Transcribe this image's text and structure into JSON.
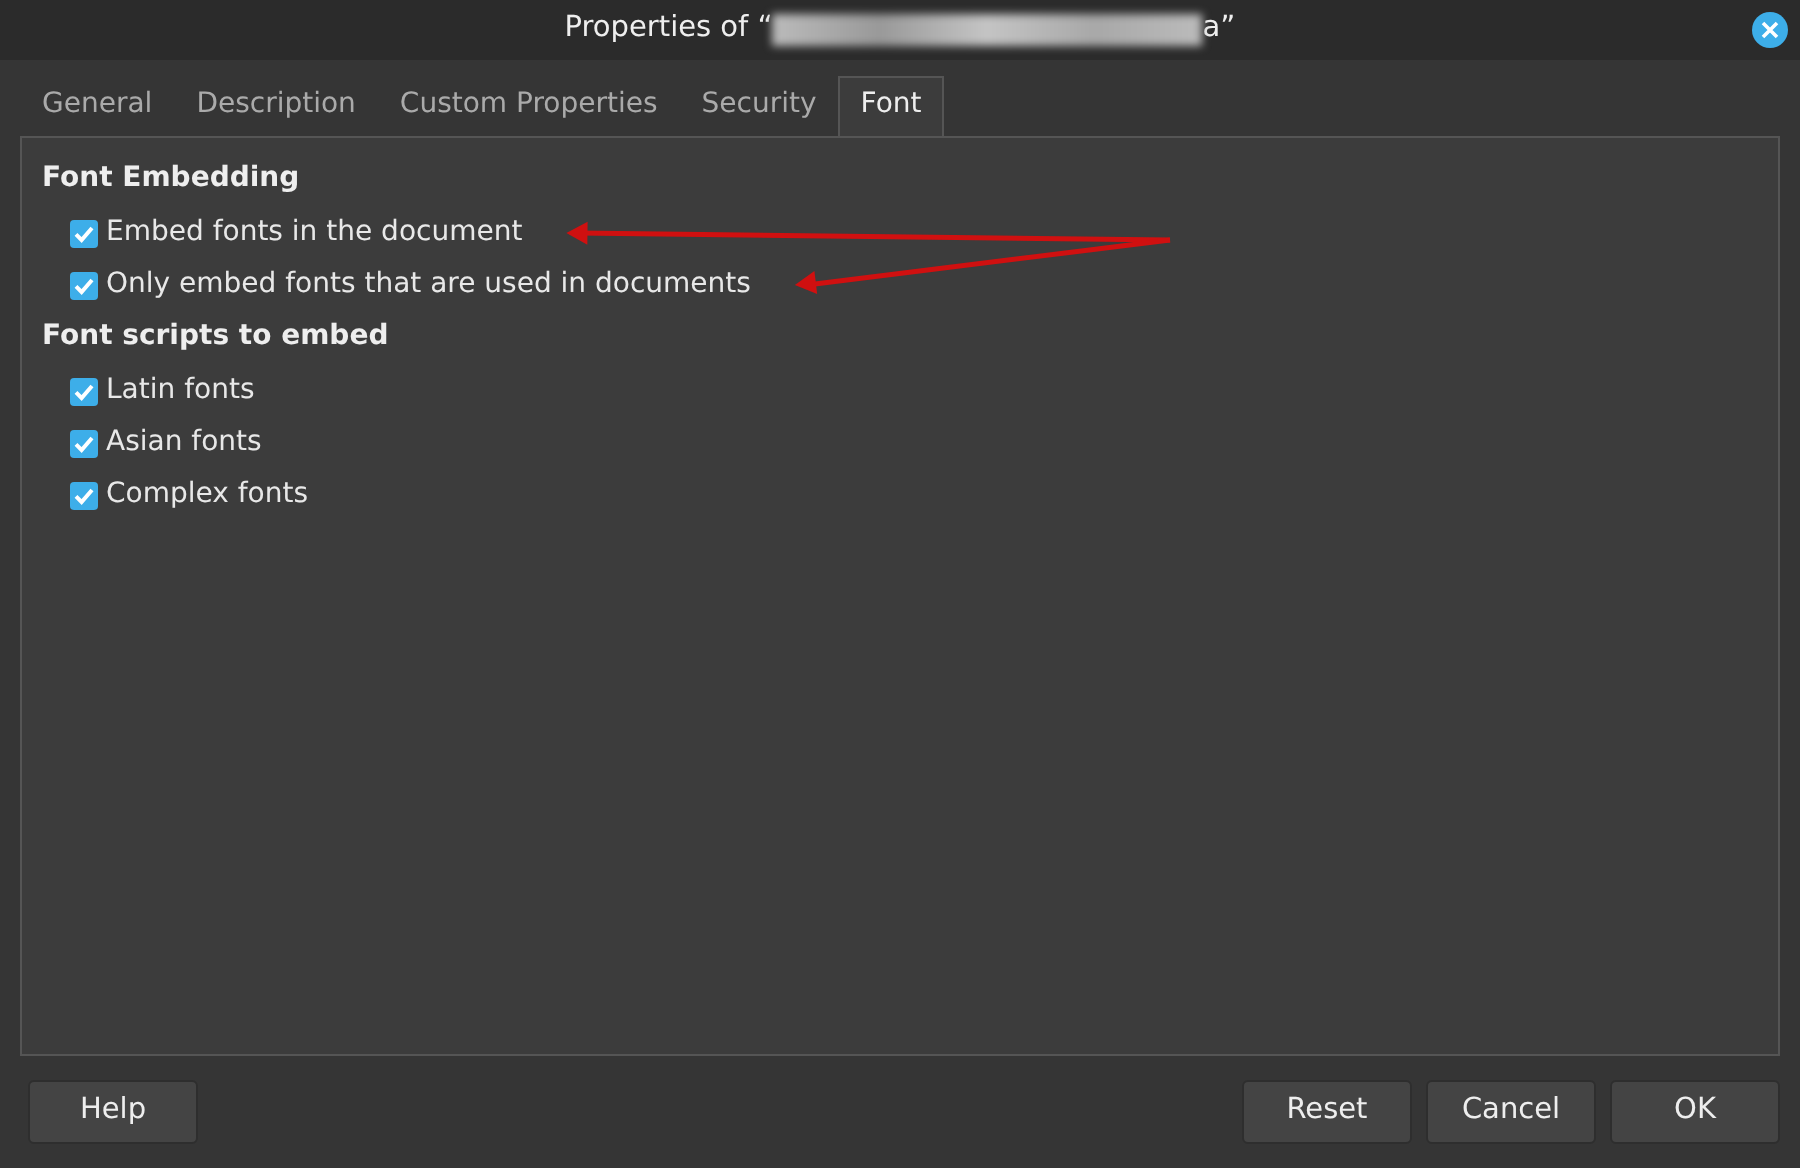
{
  "window": {
    "title_prefix": "Properties of “",
    "title_suffix": "a”",
    "title_redacted": true
  },
  "tabs": [
    {
      "label": "General",
      "selected": false
    },
    {
      "label": "Description",
      "selected": false
    },
    {
      "label": "Custom Properties",
      "selected": false
    },
    {
      "label": "Security",
      "selected": false
    },
    {
      "label": "Font",
      "selected": true
    }
  ],
  "sections": [
    {
      "heading": "Font Embedding",
      "options": [
        {
          "label": "Embed fonts in the document",
          "checked": true,
          "arrow": true
        },
        {
          "label": "Only embed fonts that are used in documents",
          "checked": true,
          "arrow": true
        }
      ]
    },
    {
      "heading": "Font scripts to embed",
      "options": [
        {
          "label": "Latin fonts",
          "checked": true,
          "arrow": false
        },
        {
          "label": "Asian fonts",
          "checked": true,
          "arrow": false
        },
        {
          "label": "Complex fonts",
          "checked": true,
          "arrow": false
        }
      ]
    }
  ],
  "buttons_left": [
    "Help"
  ],
  "buttons_right": [
    "Reset",
    "Cancel",
    "OK"
  ]
}
